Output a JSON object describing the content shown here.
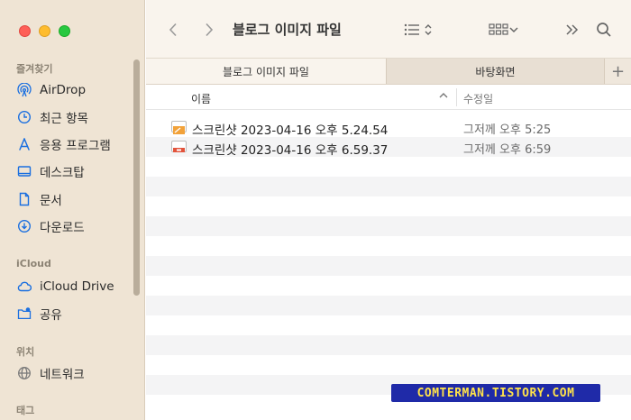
{
  "toolbar": {
    "title": "블로그 이미지 파일"
  },
  "tabs": [
    {
      "label": "블로그 이미지 파일"
    },
    {
      "label": "바탕화면"
    }
  ],
  "sidebar": {
    "favorites_header": "즐겨찾기",
    "favorites": [
      {
        "label": "AirDrop",
        "icon": "airdrop-icon"
      },
      {
        "label": "최근 항목",
        "icon": "clock-icon"
      },
      {
        "label": "응용 프로그램",
        "icon": "applications-icon"
      },
      {
        "label": "데스크탑",
        "icon": "desktop-icon"
      },
      {
        "label": "문서",
        "icon": "document-icon"
      },
      {
        "label": "다운로드",
        "icon": "download-icon"
      }
    ],
    "icloud_header": "iCloud",
    "icloud": [
      {
        "label": "iCloud Drive",
        "icon": "cloud-icon"
      },
      {
        "label": "공유",
        "icon": "shared-folder-icon"
      }
    ],
    "locations_header": "위치",
    "locations": [
      {
        "label": "네트워크",
        "icon": "network-icon"
      }
    ],
    "tags_header": "태그"
  },
  "columns": {
    "name": "이름",
    "date_modified": "수정일"
  },
  "files": [
    {
      "name": "스크린샷 2023-04-16 오후 5.24.54",
      "modified": "그저께 오후 5:25"
    },
    {
      "name": "스크린샷 2023-04-16 오후 6.59.37",
      "modified": "그저께 오후 6:59"
    }
  ],
  "watermark": "COMTERMAN.TISTORY.COM",
  "colors": {
    "sidebar_bg": "#efe4d4",
    "accent": "#1a6fe0"
  }
}
